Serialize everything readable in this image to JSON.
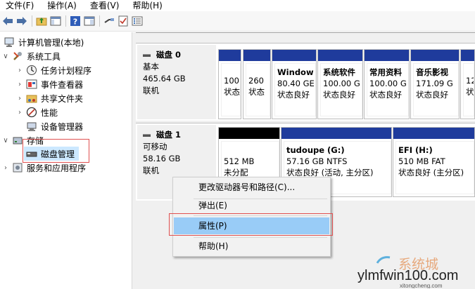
{
  "menubar": {
    "items": [
      "文件(F)",
      "操作(A)",
      "查看(V)",
      "帮助(H)"
    ]
  },
  "toolbar": {
    "icons": [
      "back-arrow-icon",
      "forward-arrow-icon",
      "folder-up-icon",
      "console-tree-icon",
      "help-icon",
      "panel-icon",
      "connect-icon",
      "check-icon",
      "list-icon"
    ]
  },
  "tree": {
    "root": "计算机管理(本地)",
    "system_tools": "系统工具",
    "task_scheduler": "任务计划程序",
    "event_viewer": "事件查看器",
    "shared_folders": "共享文件夹",
    "performance": "性能",
    "device_manager": "设备管理器",
    "storage": "存储",
    "disk_management": "磁盘管理",
    "services_apps": "服务和应用程序"
  },
  "disk0": {
    "name": "磁盘 0",
    "type": "基本",
    "size": "465.64 GB",
    "status": "联机",
    "partitions": [
      {
        "l1": "100(",
        "l2": "状态"
      },
      {
        "l1": "260",
        "l2": "状态"
      },
      {
        "l1": "Window",
        "l2": "80.40 GE",
        "l3": "状态良好"
      },
      {
        "l1": "系统软件",
        "l2": "100.00 G",
        "l3": "状态良好"
      },
      {
        "l1": "常用资料",
        "l2": "100.00 G",
        "l3": "状态良好"
      },
      {
        "l1": "音乐影视",
        "l2": "171.09 G",
        "l3": "状态良好"
      },
      {
        "l1": "12",
        "l2": "状"
      }
    ]
  },
  "disk1": {
    "name": "磁盘 1",
    "type": "可移动",
    "size": "58.16 GB",
    "status": "联机",
    "partitions": [
      {
        "l1": "512 MB",
        "l2": "未分配"
      },
      {
        "l1": "tudoupe (G:)",
        "l2": "57.16 GB NTFS",
        "l3": "状态良好 (活动, 主分区)"
      },
      {
        "l1": "EFI (H:)",
        "l2": "510 MB FAT",
        "l3": "状态良好 (主分区)"
      }
    ]
  },
  "context_menu": {
    "change_drive": "更改驱动器号和路径(C)...",
    "eject": "弹出(E)",
    "properties": "属性(P)",
    "help": "帮助(H)"
  },
  "watermark": {
    "main": "ylmfwin100.com",
    "sub": "xitongcheng.com",
    "cn": "系统城"
  },
  "colors": {
    "partition_bar": "#1f3b9c",
    "unallocated_bar": "#000000",
    "highlight": "#99ccf7",
    "red_box": "#e05050"
  }
}
